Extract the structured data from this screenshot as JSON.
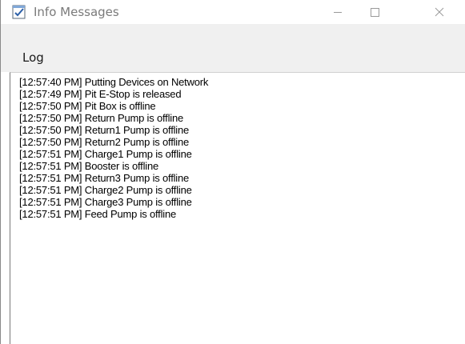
{
  "window": {
    "title": "Info Messages",
    "icon": "notepad-checkbox-icon"
  },
  "menu": {
    "items": [
      {
        "label": "Log"
      }
    ]
  },
  "log": {
    "lines": [
      "[12:57:40 PM] Putting Devices on Network",
      "[12:57:49 PM] Pit E-Stop is released",
      "[12:57:50 PM] Pit Box is offline",
      "[12:57:50 PM] Return Pump is offline",
      "[12:57:50 PM] Return1 Pump is offline",
      "[12:57:50 PM] Return2 Pump is offline",
      "[12:57:51 PM] Charge1 Pump is offline",
      "[12:57:51 PM] Booster is offline",
      "[12:57:51 PM] Return3 Pump is offline",
      "[12:57:51 PM] Charge2 Pump is offline",
      "[12:57:51 PM] Charge3 Pump is offline",
      "[12:57:51 PM] Feed Pump is offline"
    ]
  },
  "colors": {
    "title_text": "#7a7a7a",
    "menubar_bg": "#f0f0f0",
    "log_text": "#000000"
  }
}
